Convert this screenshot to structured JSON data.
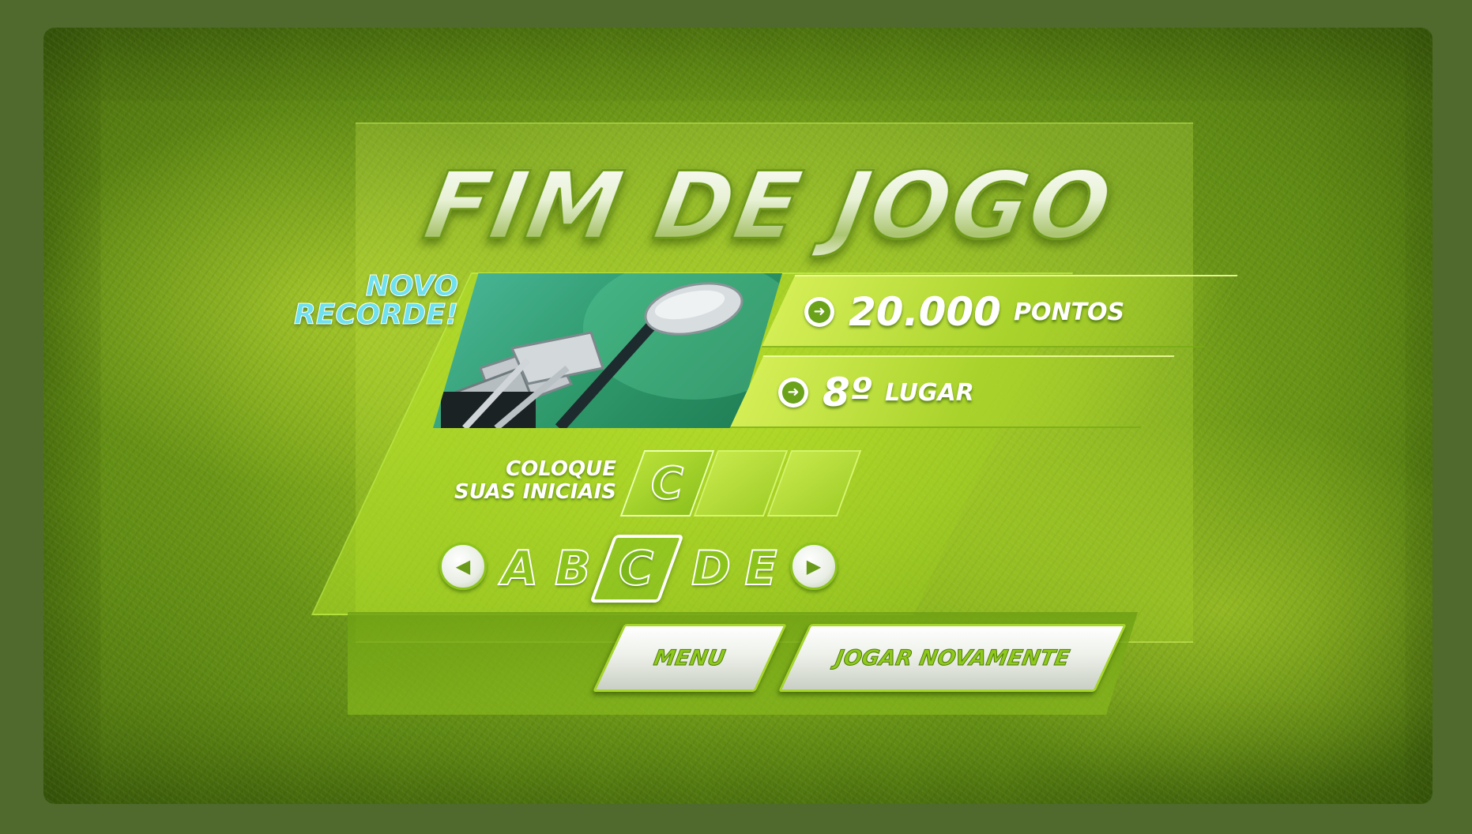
{
  "title": "FIM DE JOGO",
  "record": {
    "line1": "NOVO",
    "line2": "RECORDE!"
  },
  "score": {
    "value": "20.000",
    "unit": "PONTOS"
  },
  "rank": {
    "value": "8º",
    "unit": "LUGAR"
  },
  "initials": {
    "label_line1": "COLOQUE",
    "label_line2": "SUAS INICIAIS",
    "slots": [
      "C",
      "",
      ""
    ]
  },
  "picker": {
    "letters": [
      "A",
      "B",
      "C",
      "D",
      "E"
    ],
    "selected": "C"
  },
  "buttons": {
    "menu": "MENU",
    "play_again": "JOGAR NOVAMENTE"
  },
  "colors": {
    "accent": "#8cc41c",
    "record": "#6ee0ee"
  },
  "icons": {
    "stat_bullet": "arrow-right-circle-icon",
    "prev": "arrow-left-icon",
    "next": "arrow-right-icon"
  }
}
